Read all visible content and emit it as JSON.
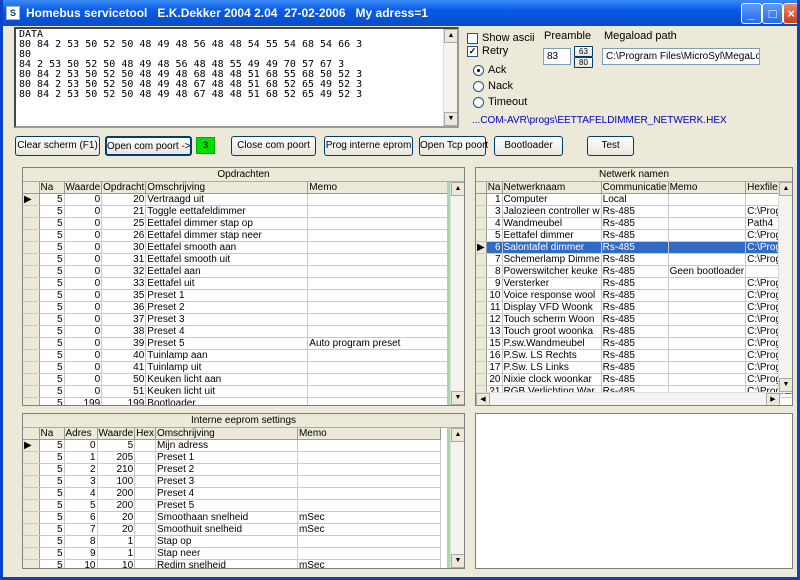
{
  "window": {
    "title": "Homebus servicetool   E.K.Dekker 2004 2.04  27-02-2006   My adress=1"
  },
  "console": {
    "lines": [
      "DATA",
      "80 84 2 53 50 52 50 48 49 48 56 48 48 54 55 54 68 54 66 3",
      "80",
      "84 2 53 50 52 50 48 49 48 56 48 48 55 49 49 70 57 67 3",
      "80 84 2 53 50 52 50 48 49 48 68 48 48 51 68 55 68 50 52 3",
      "80 84 2 53 50 52 50 48 49 48 67 48 48 51 68 52 65 49 52 3",
      "80 84 2 53 50 52 50 48 49 48 67 48 48 51 68 52 65 49 52 3"
    ]
  },
  "options": {
    "show_ascii": "Show ascii",
    "retry": "Retry",
    "ack": "Ack",
    "nack": "Nack",
    "timeout": "Timeout",
    "preamble_label": "Preamble",
    "preamble_value": "83",
    "btn_63": "63",
    "btn_80": "80",
    "megaload_label": "Megaload path",
    "megaload_value": "C:\\Program Files\\MicroSyl\\MegaLoad\\M",
    "hex_path": "...COM-AVR\\progs\\EETTAFELDIMMER_NETWERK.HEX"
  },
  "toolbar": {
    "clear": "Clear scherm (F1)",
    "open_com": "Open com poort ->",
    "indicator": "3",
    "close_com": "Close com poort",
    "prog": "Prog interne eprom",
    "open_tcp": "Open Tcp poort",
    "bootloader": "Bootloader",
    "test": "Test"
  },
  "opdrachten": {
    "title": "Opdrachten",
    "headers": [
      "Na",
      "Waarde",
      "Opdracht",
      "Omschrijving",
      "Memo"
    ],
    "rows": [
      [
        "5",
        "0",
        "20",
        "Vertraagd uit",
        ""
      ],
      [
        "5",
        "0",
        "21",
        "Toggle eettafeldimmer",
        ""
      ],
      [
        "5",
        "0",
        "25",
        "Eettafel dimmer stap op",
        ""
      ],
      [
        "5",
        "0",
        "26",
        "Eettafel dimmer stap neer",
        ""
      ],
      [
        "5",
        "0",
        "30",
        "Eettafel smooth aan",
        ""
      ],
      [
        "5",
        "0",
        "31",
        "Eettafel smooth uit",
        ""
      ],
      [
        "5",
        "0",
        "32",
        "Eettafel aan",
        ""
      ],
      [
        "5",
        "0",
        "33",
        "Eettafel uit",
        ""
      ],
      [
        "5",
        "0",
        "35",
        "Preset 1",
        ""
      ],
      [
        "5",
        "0",
        "36",
        "Preset 2",
        ""
      ],
      [
        "5",
        "0",
        "37",
        "Preset 3",
        ""
      ],
      [
        "5",
        "0",
        "38",
        "Preset 4",
        ""
      ],
      [
        "5",
        "0",
        "39",
        "Preset 5",
        "Auto program preset"
      ],
      [
        "5",
        "0",
        "40",
        "Tuinlamp aan",
        ""
      ],
      [
        "5",
        "0",
        "41",
        "Tuinlamp uit",
        ""
      ],
      [
        "5",
        "0",
        "50",
        "Keuken licht aan",
        ""
      ],
      [
        "5",
        "0",
        "51",
        "Keuken licht uit",
        ""
      ],
      [
        "5",
        "199",
        "199",
        "Bootloader",
        ""
      ]
    ]
  },
  "netwerk": {
    "title": "Netwerk namen",
    "headers": [
      "Na",
      "Netwerknaam",
      "Communicatie",
      "Memo",
      "Hexfile Path"
    ],
    "selected": 4,
    "rows": [
      [
        "1",
        "Computer",
        "Local",
        "",
        ""
      ],
      [
        "3",
        "Jalozieen controller w",
        "Rs-485",
        "",
        "C:\\Program"
      ],
      [
        "4",
        "Wandmeubel",
        "Rs-485",
        "",
        "Path4"
      ],
      [
        "5",
        "Eettafel dimmer",
        "Rs-485",
        "",
        "C:\\Program"
      ],
      [
        "6",
        "Salontafel dimmer",
        "Rs-485",
        "",
        "C:\\Program"
      ],
      [
        "7",
        "Schemerlamp Dimme",
        "Rs-485",
        "",
        "C:\\Program"
      ],
      [
        "8",
        "Powerswitcher keuke",
        "Rs-485",
        "Geen bootloader",
        ""
      ],
      [
        "9",
        "Versterker",
        "Rs-485",
        "",
        "C:\\Program"
      ],
      [
        "10",
        "Voice response wool",
        "Rs-485",
        "",
        "C:\\Program"
      ],
      [
        "11",
        "Display VFD Woonk",
        "Rs-485",
        "",
        "C:\\Program"
      ],
      [
        "12",
        "Touch scherm Woon",
        "Rs-485",
        "",
        "C:\\Program"
      ],
      [
        "13",
        "Touch groot woonka",
        "Rs-485",
        "",
        "C:\\Program"
      ],
      [
        "15",
        "P.sw.Wandmeubel",
        "Rs-485",
        "",
        "C:\\Program"
      ],
      [
        "16",
        "P.Sw. LS Rechts",
        "Rs-485",
        "",
        "C:\\Program"
      ],
      [
        "17",
        "P.Sw. LS Links",
        "Rs-485",
        "",
        "C:\\Program"
      ],
      [
        "20",
        "Nixie clock woonkar",
        "Rs-485",
        "",
        "C:\\Program"
      ],
      [
        "21",
        "RGB Verlichting War",
        "Rs-485",
        "",
        "C:\\Program"
      ]
    ]
  },
  "eeprom": {
    "title": "Interne eeprom settings",
    "headers": [
      "Na",
      "Adres",
      "Waarde",
      "Hex",
      "Omschrijving",
      "Memo"
    ],
    "rows": [
      [
        "5",
        "0",
        "5",
        "",
        "Mijn adress",
        ""
      ],
      [
        "5",
        "1",
        "205",
        "",
        "Preset 1",
        ""
      ],
      [
        "5",
        "2",
        "210",
        "",
        "Preset 2",
        ""
      ],
      [
        "5",
        "3",
        "100",
        "",
        "Preset 3",
        ""
      ],
      [
        "5",
        "4",
        "200",
        "",
        "Preset 4",
        ""
      ],
      [
        "5",
        "5",
        "200",
        "",
        "Preset 5",
        ""
      ],
      [
        "5",
        "6",
        "20",
        "",
        "Smoothaan snelheid",
        "mSec"
      ],
      [
        "5",
        "7",
        "20",
        "",
        "Smoothuit snelheid",
        "mSec"
      ],
      [
        "5",
        "8",
        "1",
        "",
        "Stap op",
        ""
      ],
      [
        "5",
        "9",
        "1",
        "",
        "Stap neer",
        ""
      ],
      [
        "5",
        "10",
        "10",
        "",
        "Redim snelheid",
        "mSec"
      ]
    ]
  }
}
